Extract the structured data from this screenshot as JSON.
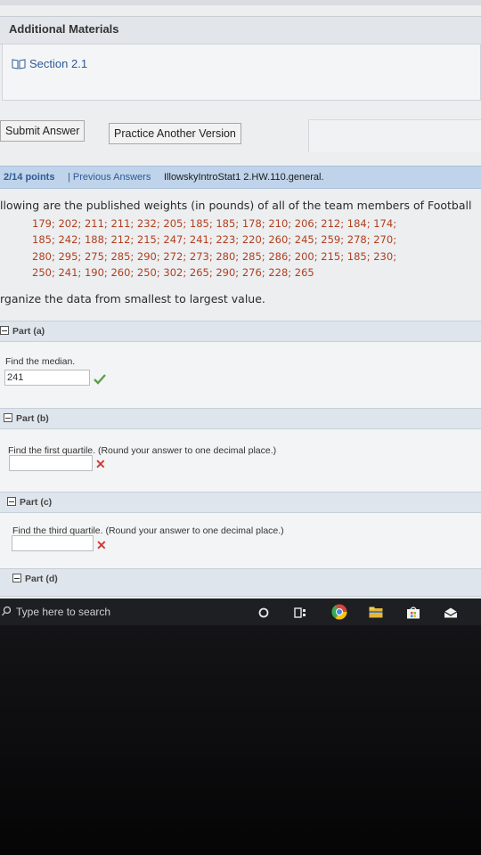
{
  "additional_materials": {
    "title": "Additional Materials",
    "section_link": "Section 2.1"
  },
  "buttons": {
    "submit": "Submit Answer",
    "practice": "Practice Another Version"
  },
  "question": {
    "points": "2/14 points",
    "previous_answers": "| Previous Answers",
    "id": "IllowskyIntroStat1 2.HW.110.general.",
    "intro": "llowing are the published weights (in pounds) of all of the team members of Football",
    "data_lines": [
      "179; 202; 211; 211; 232; 205; 185; 185; 178; 210; 206; 212; 184; 174;",
      "185; 242; 188; 212; 215; 247; 241; 223; 220; 260; 245; 259; 278; 270;",
      "280; 295; 275; 285; 290; 272; 273; 280; 285; 286; 200; 215; 185; 230;",
      "250; 241; 190; 260; 250; 302; 265; 290; 276; 228; 265"
    ],
    "instruction": "rganize the data from smallest to largest value."
  },
  "parts": {
    "a": {
      "label": "Part (a)",
      "prompt": "Find the median.",
      "value": "241",
      "status": "correct"
    },
    "b": {
      "label": "Part (b)",
      "prompt": "Find the first quartile. (Round your answer to one decimal place.)",
      "value": "",
      "status": "incorrect"
    },
    "c": {
      "label": "Part (c)",
      "prompt": "Find the third quartile. (Round your answer to one decimal place.)",
      "value": "",
      "status": "incorrect"
    },
    "d": {
      "label": "Part (d)"
    }
  },
  "taskbar": {
    "search_placeholder": "Type here to search",
    "icons": [
      "cortana-icon",
      "task-view-icon",
      "chrome-icon",
      "file-explorer-icon",
      "store-icon",
      "mail-icon"
    ]
  },
  "colors": {
    "link_blue": "#2d5a95",
    "data_orange": "#b0401f",
    "correct_green": "#5aa04a",
    "incorrect_red": "#d23a3a",
    "question_header_bg": "#bfd3ea"
  }
}
